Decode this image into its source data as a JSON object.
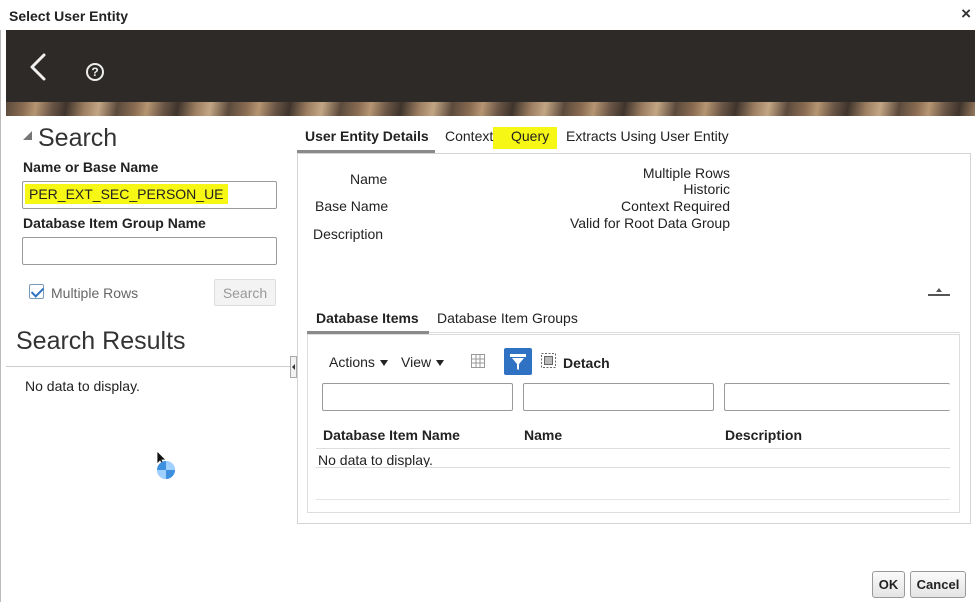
{
  "dialog": {
    "title": "Select User Entity",
    "close_glyph": "×"
  },
  "header": {
    "back_icon": "chevron-left-icon",
    "help_icon": "question-circle-icon",
    "help_glyph": "?"
  },
  "search": {
    "heading": "Search",
    "name_label": "Name or Base Name",
    "name_value": "PER_EXT_SEC_PERSON_UE",
    "group_label": "Database Item Group Name",
    "group_value": "",
    "multiple_rows_label": "Multiple Rows",
    "multiple_rows_checked": true,
    "search_button": "Search"
  },
  "results": {
    "heading": "Search Results",
    "empty_text": "No data to display."
  },
  "tabs": [
    {
      "label": "User Entity Details",
      "active": true
    },
    {
      "label": "Context",
      "active": false
    },
    {
      "label": "Query",
      "active": false,
      "highlighted": true
    },
    {
      "label": "Extracts Using User Entity",
      "active": false
    }
  ],
  "details": {
    "left_labels": [
      "Name",
      "Base Name",
      "Description"
    ],
    "right_labels": [
      "Multiple Rows",
      "Historic",
      "Context Required",
      "Valid for Root Data Group"
    ]
  },
  "subtabs": [
    {
      "label": "Database Items",
      "active": true
    },
    {
      "label": "Database Item Groups",
      "active": false
    }
  ],
  "toolbar": {
    "actions": "Actions",
    "view": "View",
    "detach": "Detach"
  },
  "table": {
    "columns": [
      "Database Item Name",
      "Name",
      "Description"
    ],
    "empty_text": "No data to display."
  },
  "buttons": {
    "ok": "OK",
    "cancel": "Cancel"
  },
  "colors": {
    "highlight": "#f7f716",
    "accent": "#2f72c4",
    "banner": "#2d2a27"
  }
}
